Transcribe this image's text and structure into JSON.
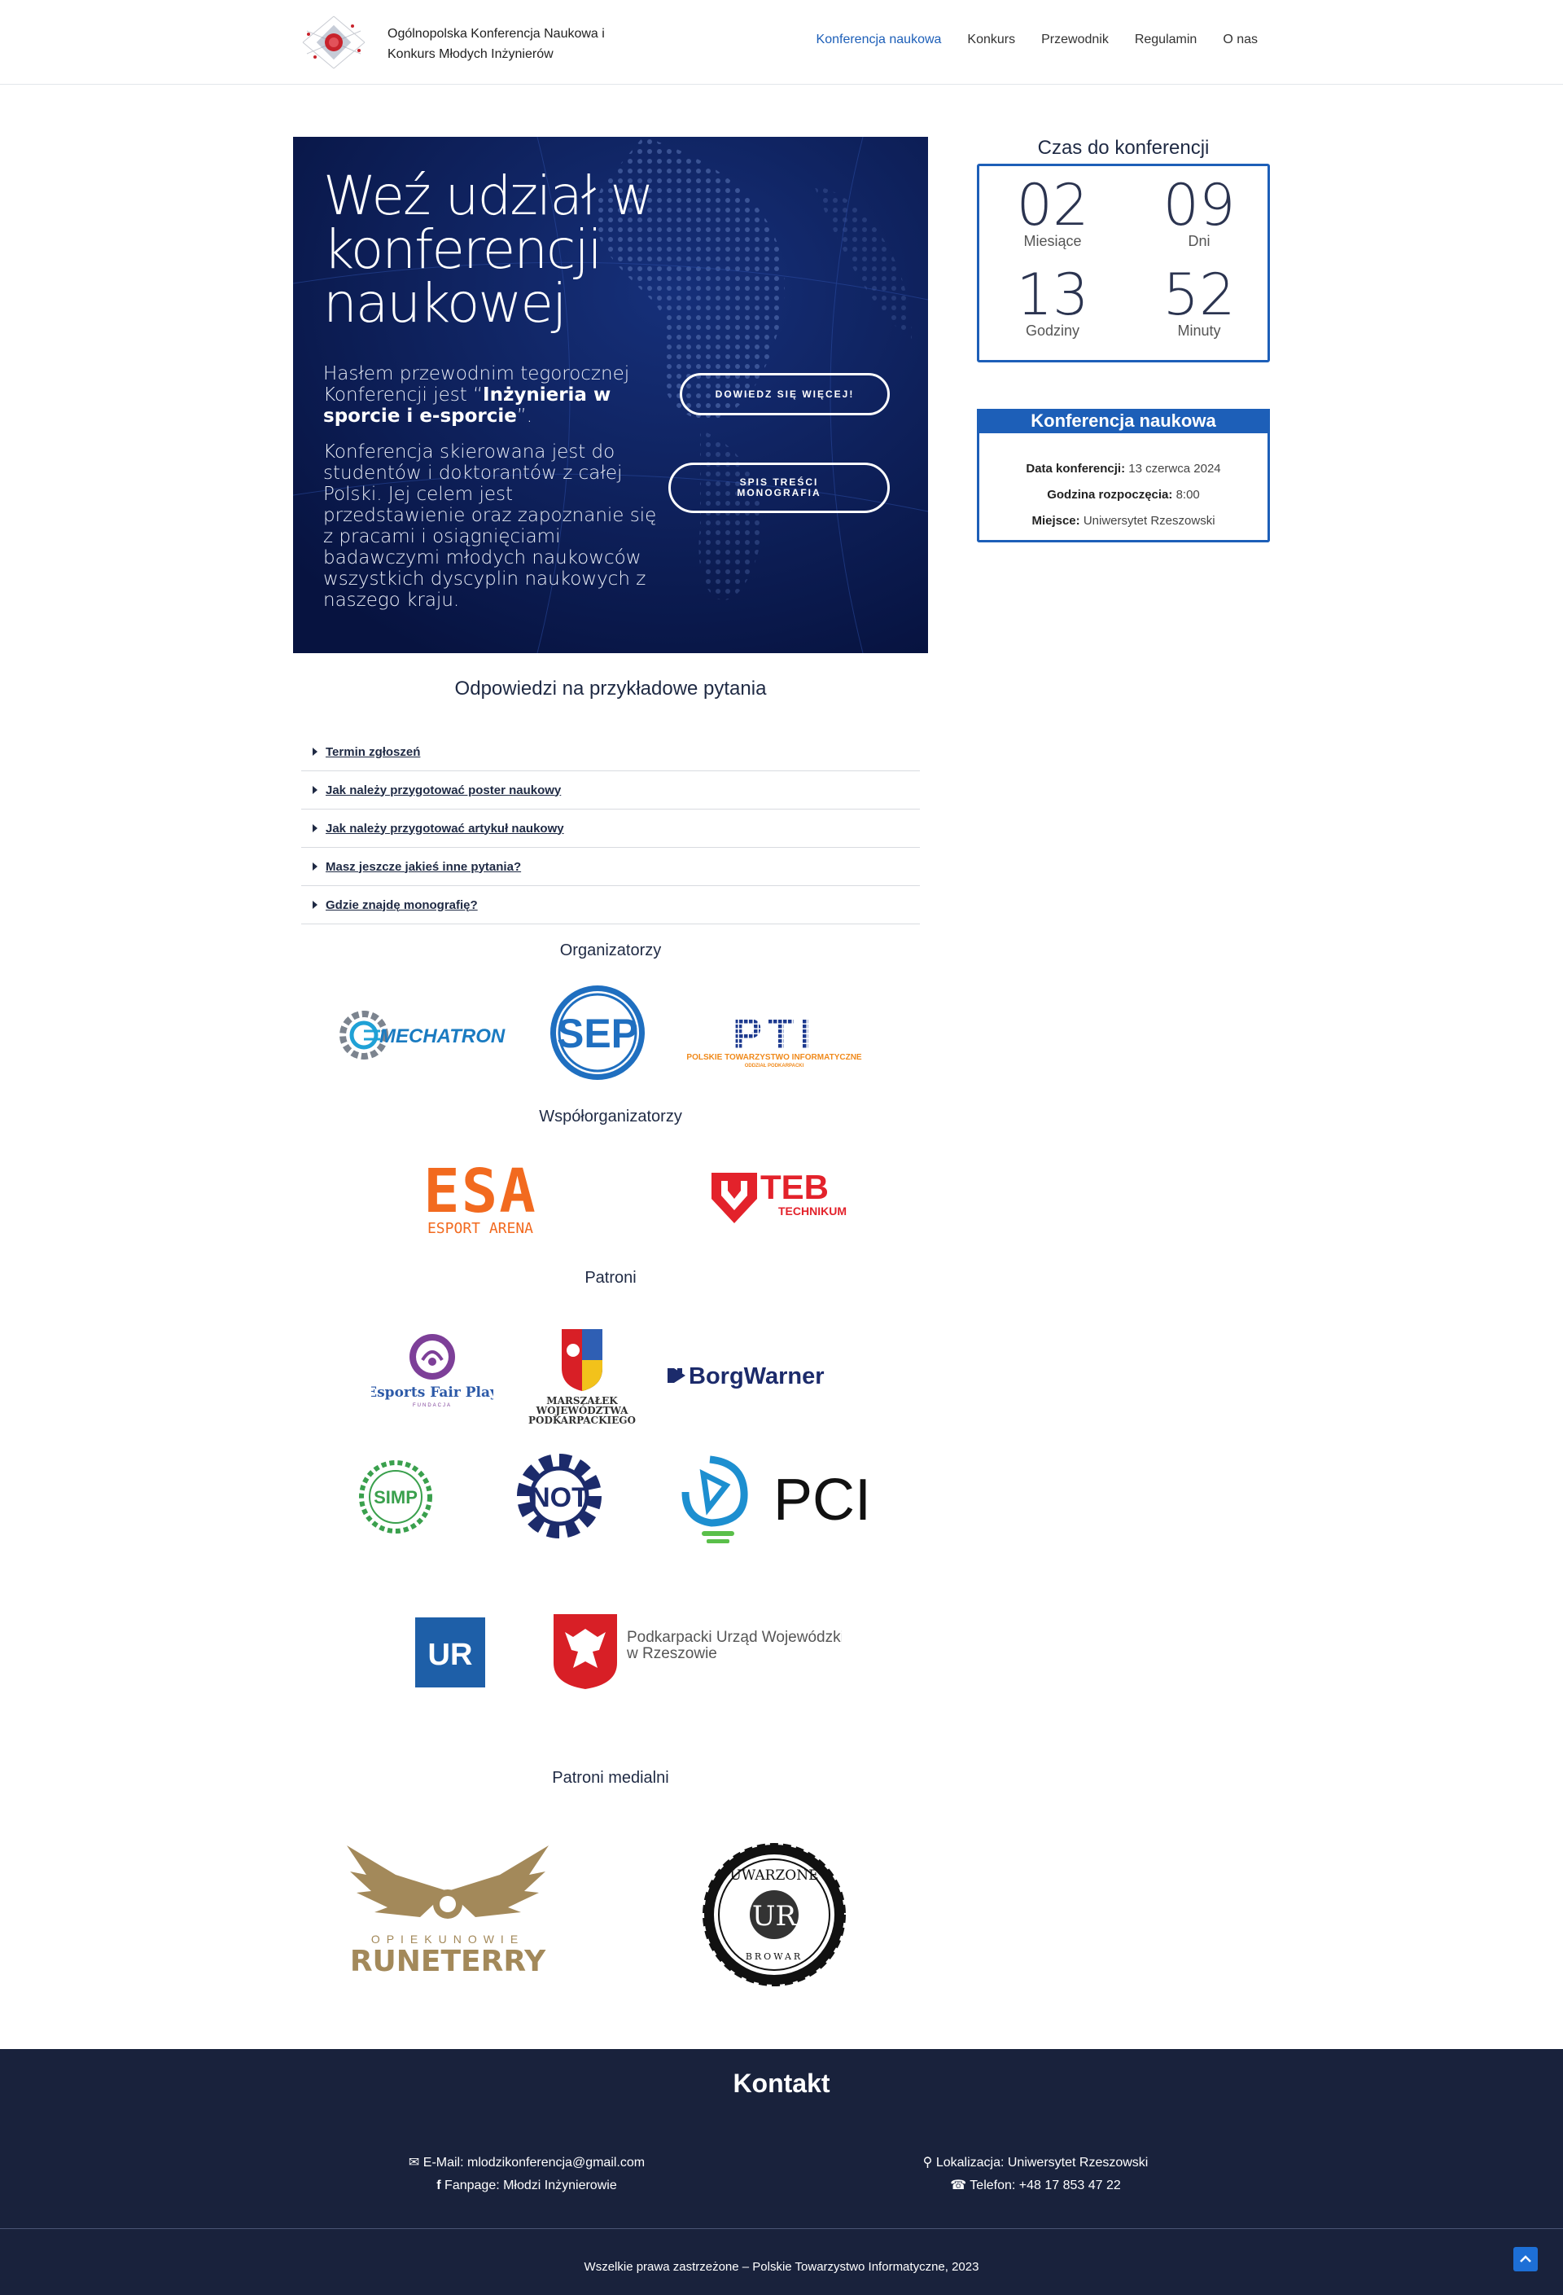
{
  "header": {
    "brand_line1": "Ogólnopolska Konferencja Naukowa i",
    "brand_line2": "Konkurs Młodych Inżynierów",
    "nav": [
      "Konferencja naukowa",
      "Konkurs",
      "Przewodnik",
      "Regulamin",
      "O nas"
    ],
    "active_nav": "Konferencja naukowa",
    "accent_color": "#1d5fb8"
  },
  "hero": {
    "title": "Weź udział w konferencji naukowej",
    "p1_a": "Hasłem przewodnim tegorocznej Konferencji jest “",
    "p1_b": "Inżynieria w sporcie i e-sporcie",
    "p1_c": "”.",
    "p2": "Konferencja skierowana jest do studentów i doktorantów z całej Polski. Jej celem jest przedstawienie oraz zapoznanie się z pracami i osiągnięciami badawczymi młodych naukowców wszystkich dyscyplin naukowych z naszego kraju.",
    "btn_more": "DOWIEDZ SIĘ WIĘCEJ!",
    "btn_toc": "SPIS TREŚCI MONOGRAFIA"
  },
  "countdown": {
    "title": "Czas do konferencji",
    "months": "02",
    "months_label": "Miesiące",
    "days": "09",
    "days_label": "Dni",
    "hours": "13",
    "hours_label": "Godziny",
    "minutes": "52",
    "minutes_label": "Minuty"
  },
  "info": {
    "heading": "Konferencja naukowa",
    "date_label": "Data konferencji:",
    "date_value": "13 czerwca 2024",
    "time_label": "Godzina rozpoczęcia:",
    "time_value": "8:00",
    "place_label": "Miejsce:",
    "place_value": "Uniwersytet Rzeszowski"
  },
  "faq": {
    "title": "Odpowiedzi na przykładowe pytania",
    "items": [
      "Termin zgłoszeń",
      "Jak należy przygotować poster naukowy",
      "Jak należy przygotować artykuł naukowy",
      "Masz jeszcze jakieś inne pytania?",
      "Gdzie znajdę monografię?"
    ]
  },
  "sections": {
    "organizers": "Organizatorzy",
    "coorganizers": "Współorganizatorzy",
    "patrons": "Patroni",
    "media_patrons": "Patroni medialni"
  },
  "logos": {
    "mechatron": "MECHATRON",
    "sep": "SEP",
    "pti": "PTI",
    "pti_sub1": "POLSKIE TOWARZYSTWO INFORMATYCZNE",
    "pti_sub2": "ODDZIAŁ PODKARPACKI",
    "esa": "ESA",
    "esa_sub": "ESPORT ARENA",
    "teb": "TEB",
    "teb_sub": "TECHNIKUM",
    "efp": "Esports Fair Play",
    "efp_sub": "FUNDACJA",
    "marszalek1": "MARSZAŁEK",
    "marszalek2": "WOJEWÓDZTWA",
    "marszalek3": "PODKARPACKIEGO",
    "borgwarner": "BorgWarner",
    "simp": "SIMP",
    "not": "NOT",
    "pci": "PCI",
    "ur": "UR",
    "puw1": "Podkarpacki Urząd Wojewódzki",
    "puw2": "w Rzeszowie",
    "runeterry1": "OPIEKUNOWIE",
    "runeterry2": "RUNETERRY",
    "browar1": "UWARZONE",
    "browar2": "UR",
    "browar3": "BROWAR"
  },
  "footer": {
    "title": "Kontakt",
    "email": "E-Mail: mlodzikonferencja@gmail.com",
    "fanpage": "Fanpage: Młodzi Inżynierowie",
    "location": "Lokalizacja: Uniwersytet Rzeszowski",
    "phone": "Telefon: +48 17 853 47 22",
    "copyright": "Wszelkie prawa zastrzeżone – Polskie Towarzystwo Informatyczne, 2023"
  }
}
